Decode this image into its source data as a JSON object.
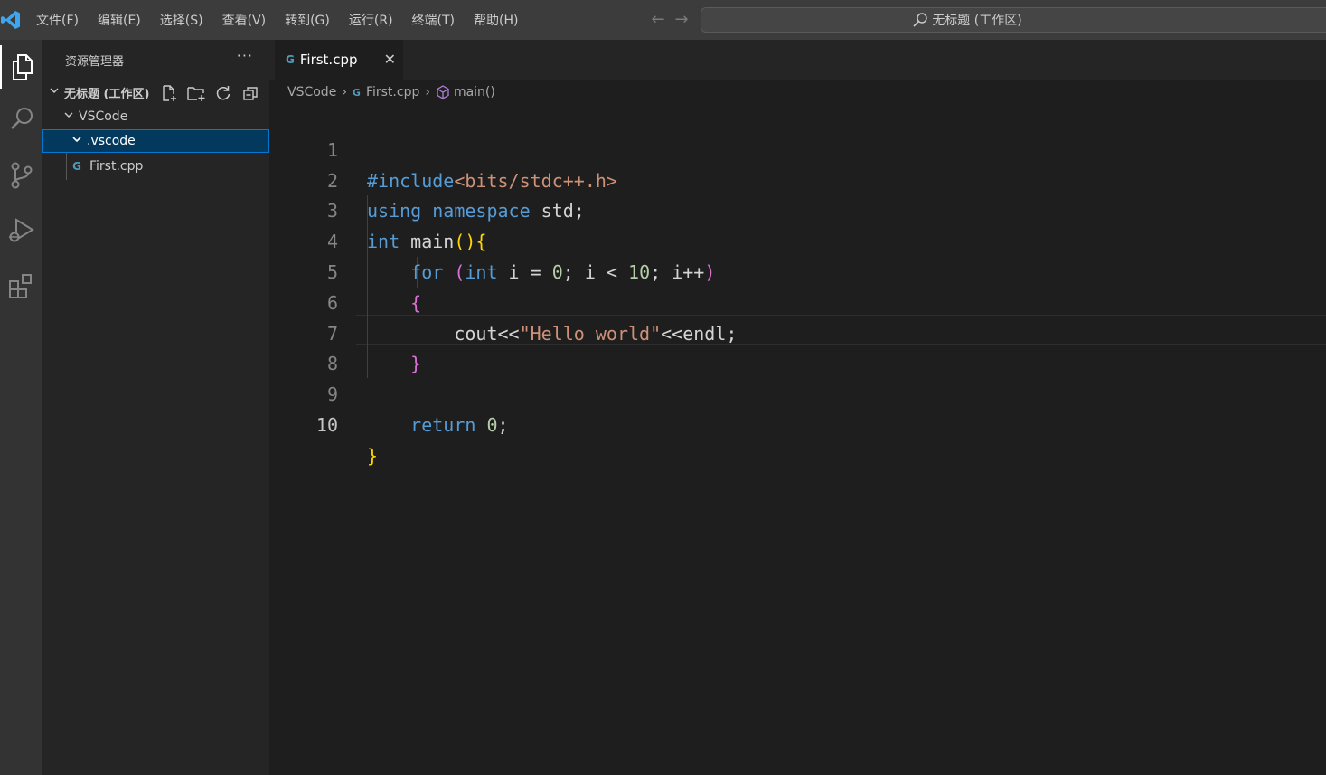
{
  "titlebar": {
    "menu": [
      "文件(F)",
      "编辑(E)",
      "选择(S)",
      "查看(V)",
      "转到(G)",
      "运行(R)",
      "终端(T)",
      "帮助(H)"
    ],
    "back_arrow": "←",
    "forward_arrow": "→",
    "command_center": "无标题 (工作区)"
  },
  "activitybar": {
    "icons": [
      "explorer-icon",
      "search-icon",
      "source-control-icon",
      "run-debug-icon",
      "extensions-icon"
    ]
  },
  "sidebar": {
    "title": "资源管理器",
    "more": "···",
    "workspace": "无标题 (工作区)",
    "folder": "VSCode",
    "subfolder": ".vscode",
    "file": "First.cpp"
  },
  "editor": {
    "tab_label": "First.cpp",
    "close_glyph": "✕",
    "breadcrumb": [
      "VSCode",
      "First.cpp",
      "main()"
    ],
    "line_numbers": [
      "1",
      "2",
      "3",
      "4",
      "5",
      "6",
      "7",
      "8",
      "9",
      "10"
    ],
    "code": {
      "l1_directive": "#include",
      "l1_header": "<bits/stdc++.h>",
      "l2_using": "using",
      "l2_namespace": "namespace",
      "l2_rest": " std;",
      "l3_int": "int",
      "l3_main": " main",
      "l3_parens": "()",
      "l3_brace": "{",
      "l4_for": "for",
      "l4_open": "(",
      "l4_int": "int",
      "l4_a": " i = ",
      "l4_zero": "0",
      "l4_b": "; i < ",
      "l4_ten": "10",
      "l4_c": "; i++",
      "l4_close": ")",
      "l5_brace": "{",
      "l6_cout": "cout<<",
      "l6_str": "\"Hello world\"",
      "l6_end": "<<endl;",
      "l7_brace": "}",
      "l9_return": "return",
      "l9_zero": "0",
      "l9_semi": ";",
      "l10_brace": "}"
    }
  },
  "colors": {
    "keyword": "#569cd6",
    "string": "#ce9178",
    "number": "#b5cea8",
    "bracket_gold": "#ffd700",
    "bracket_orchid": "#da70d6",
    "selection": "#04395e",
    "focus_border": "#0078d4"
  }
}
